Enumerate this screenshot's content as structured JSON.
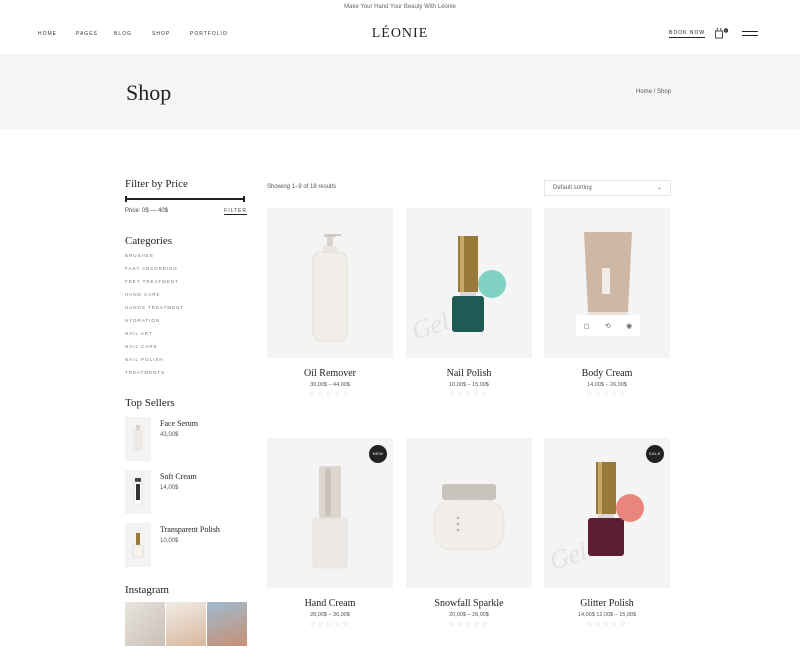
{
  "topbar": {
    "text": "Make Your Hand Your Beauty With Léonie"
  },
  "nav": {
    "items": [
      "HOME",
      "PAGES",
      "BLOG",
      "SHOP",
      "PORTFOLIO"
    ]
  },
  "logo": "LÉONIE",
  "header": {
    "book_now": "BOOK NOW",
    "cart_count": "0"
  },
  "page": {
    "title": "Shop",
    "breadcrumb": "Home / Shop"
  },
  "filter": {
    "title": "Filter by Price",
    "price_label": "Price: 0$ — 40$",
    "button": "FILTER"
  },
  "categories": {
    "title": "Categories",
    "items": [
      "Brushes",
      "Fast Absorbing",
      "Feet Treatment",
      "Hand Care",
      "Hands Treatment",
      "Hydration",
      "Nail Art",
      "Nail Care",
      "Nail Polish",
      "Treatments"
    ]
  },
  "top_sellers": {
    "title": "Top Sellers",
    "items": [
      {
        "name": "Face Serum",
        "price": "43,00$"
      },
      {
        "name": "Soft Cream",
        "price": "14,00$"
      },
      {
        "name": "Transparent Polish",
        "price": "10,00$"
      }
    ]
  },
  "instagram": {
    "title": "Instagram"
  },
  "toolbar": {
    "showing": "Showing 1–9 of 18 results",
    "sort": "Default sorting"
  },
  "products": [
    {
      "name": "Oil Remover",
      "price": "30,00$ – 44,00$",
      "badge": ""
    },
    {
      "name": "Nail Polish",
      "price": "10,00$ – 15,00$",
      "badge": "",
      "label": "Gel"
    },
    {
      "name": "Body Cream",
      "price": "14,00$ – 26,00$",
      "badge": ""
    },
    {
      "name": "Hand Cream",
      "price": "28,00$ – 36,00$",
      "badge": "NEW"
    },
    {
      "name": "Snowfall Sparkle",
      "price": "20,00$ – 28,00$",
      "badge": ""
    },
    {
      "name": "Glitter Polish",
      "price": "14,00$ 12,00$ – 15,00$",
      "badge": "SALE",
      "label": "Gel"
    }
  ],
  "colors": {
    "accent": "#222222",
    "bg_light": "#f5f5f5",
    "teal": "#1f5a55",
    "teal_cap": "#7fd1c4",
    "plum": "#5b1e34",
    "pink_cap": "#e8867d",
    "gold": "#9a7a3a"
  }
}
